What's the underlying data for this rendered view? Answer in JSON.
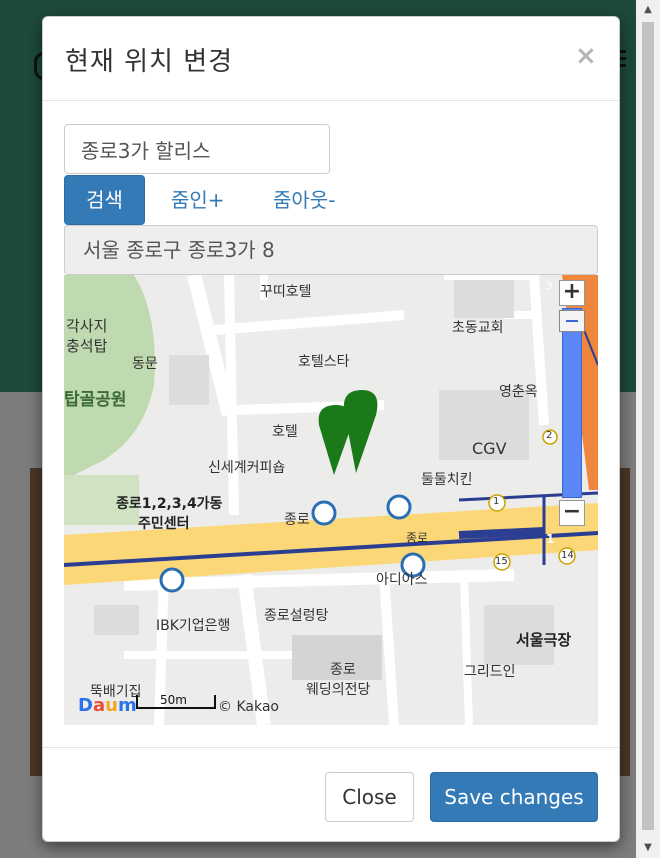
{
  "modal": {
    "title": "현재 위치 변경",
    "close_glyph": "×",
    "search_value": "종로3가 할리스",
    "search_button": "검색",
    "zoom_in_label": "줌인+",
    "zoom_out_label": "줌아웃-",
    "address": "서울 종로구 종로3가 8"
  },
  "map": {
    "labels": [
      "꾸띠호텔",
      "각사지",
      "충석탑",
      "동문",
      "탑골공원",
      "호텔스타",
      "초동교회",
      "영춘옥",
      "CGV",
      "호텔",
      "신세계커피숍",
      "둘둘치킨",
      "종로1,2,3,4가동",
      "주민센터",
      "종로",
      "종로",
      "아디아스",
      "IBK기업은행",
      "종로설렁탕",
      "서울극장",
      "종로",
      "웨딩의전당",
      "그리드인",
      "뚝배기집"
    ],
    "line_numbers": [
      "1",
      "1",
      "2",
      "3",
      "15",
      "14"
    ],
    "zoom_in": "+",
    "zoom_out": "−",
    "scale_label": "50m",
    "copyright": "© Kakao",
    "logo_text": "Daum",
    "colors": {
      "road": "#fbd777",
      "subway_line": "#2c3e92",
      "park": "#bfd9b0",
      "marker": "#1a7a1a",
      "zoom": "#5b87f5"
    }
  },
  "footer": {
    "close_label": "Close",
    "save_label": "Save changes"
  }
}
